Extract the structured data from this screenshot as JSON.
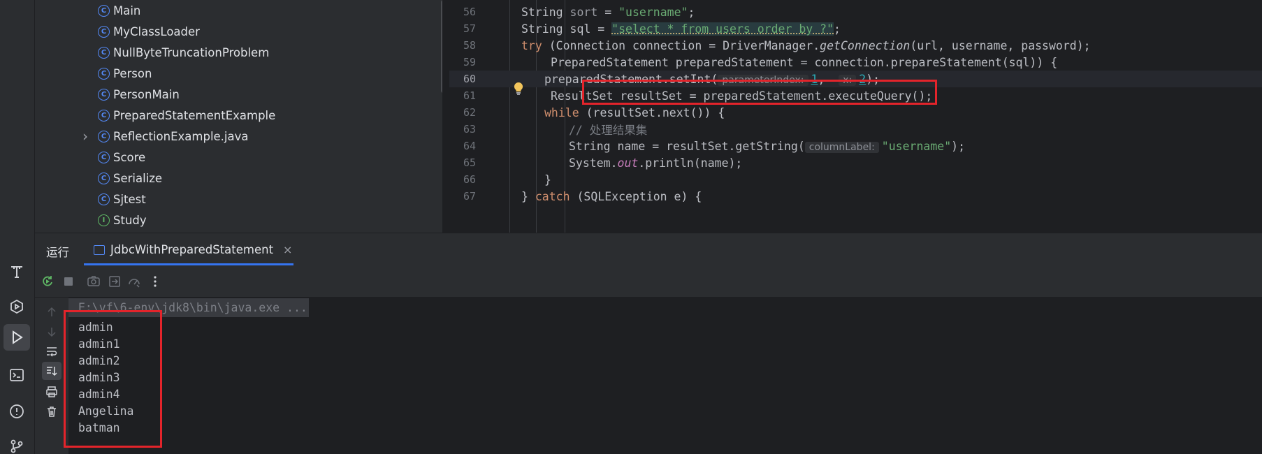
{
  "activity_bar": {
    "items": [
      {
        "icon": "text-tool-icon"
      },
      {
        "icon": "services-icon"
      },
      {
        "icon": "run-icon",
        "active": true
      },
      {
        "icon": "terminal-icon"
      },
      {
        "icon": "problems-icon"
      },
      {
        "icon": "git-icon"
      }
    ]
  },
  "project_tree": {
    "items": [
      {
        "label": "Main",
        "kind": "class"
      },
      {
        "label": "MyClassLoader",
        "kind": "class"
      },
      {
        "label": "NullByteTruncationProblem",
        "kind": "class"
      },
      {
        "label": "Person",
        "kind": "class"
      },
      {
        "label": "PersonMain",
        "kind": "class"
      },
      {
        "label": "PreparedStatementExample",
        "kind": "class"
      },
      {
        "label": "ReflectionExample.java",
        "kind": "class",
        "collapsed": true
      },
      {
        "label": "Score",
        "kind": "class"
      },
      {
        "label": "Serialize",
        "kind": "class"
      },
      {
        "label": "Sjtest",
        "kind": "class"
      },
      {
        "label": "Study",
        "kind": "interface"
      }
    ],
    "class_icon_glyph": "C",
    "interface_icon_glyph": "I"
  },
  "editor": {
    "current_line": "60",
    "lines": [
      {
        "num": "56",
        "indent": "String ",
        "var": "sort",
        "rest": " = ",
        "str": "\"username\"",
        "end": ";"
      },
      {
        "num": "57",
        "a": "String sql = ",
        "str": "\"select * from users order by ?\"",
        "end": ";"
      },
      {
        "num": "58",
        "kw": "try",
        "a": " (Connection connection = DriverManager.",
        "method": "getConnection",
        "b": "(url, username, password);"
      },
      {
        "num": "59",
        "a": "PreparedStatement preparedStatement = connection.prepareStatement(sql)) {"
      },
      {
        "num": "60",
        "a": "preparedStatement.setInt(",
        "hint1": "parameterIndex:",
        "arg1": "1",
        "sep": ",  ",
        "hint2": "x:",
        "arg2": "2",
        "b": ");"
      },
      {
        "num": "61",
        "a": "ResultSet resultSet = preparedStatement.executeQuery();"
      },
      {
        "num": "62",
        "kw": "while",
        "a": " (resultSet.next()) {"
      },
      {
        "num": "63",
        "cmt": "// 处理结果集"
      },
      {
        "num": "64",
        "a": "String name = resultSet.getString(",
        "hint1": "columnLabel:",
        "str": "\"username\"",
        "b": ");"
      },
      {
        "num": "65",
        "a": "System.",
        "field": "out",
        "b": ".println(name);"
      },
      {
        "num": "66",
        "a": "}"
      },
      {
        "num": "67",
        "a": "} ",
        "kw": "catch",
        "b": " (SQLException e) {"
      }
    ]
  },
  "run_window": {
    "title": "运行",
    "tab_label": "JdbcWithPreparedStatement",
    "tab_close": "×",
    "toolbar": [
      "rerun-icon",
      "stop-icon",
      "camera-icon",
      "exit-icon",
      "dashboard-icon",
      "more-icon"
    ],
    "side_tools": [
      "arrow-up-icon",
      "arrow-down-icon",
      "soft-wrap-icon",
      "scroll-to-end-icon",
      "print-icon",
      "trash-icon"
    ],
    "command_line": "E:\\vf\\6-env\\jdk8\\bin\\java.exe ...",
    "output": [
      "admin",
      "admin1",
      "admin2",
      "admin3",
      "admin4",
      "Angelina",
      "batman"
    ]
  },
  "colors": {
    "accent": "#3574f0",
    "highlight_box": "#e3242b",
    "keyword": "#cf8e6d",
    "string": "#6aab73",
    "number": "#2aacb8"
  }
}
